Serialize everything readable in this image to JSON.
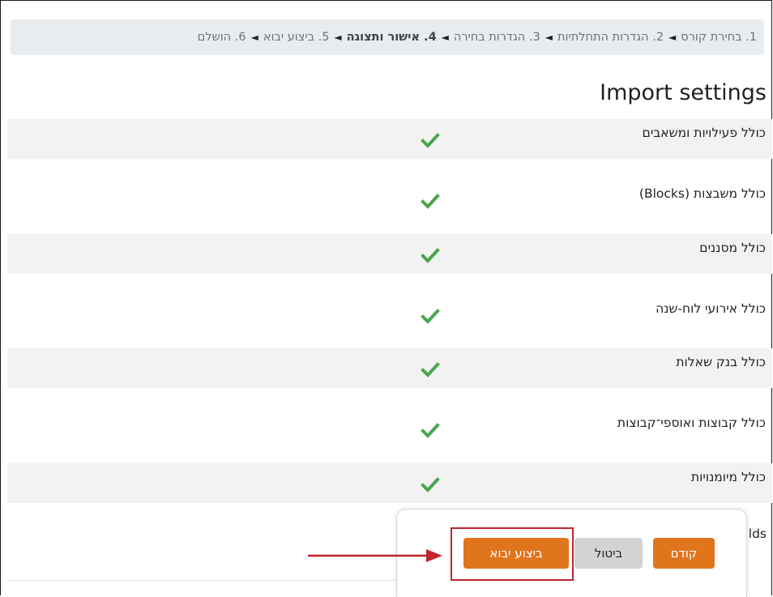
{
  "breadcrumb": {
    "separator": "◄",
    "steps": [
      {
        "label": "1. בחירת קורס",
        "current": false
      },
      {
        "label": "2. הגדרות התחלתיות",
        "current": false
      },
      {
        "label": "3. הגדרות בחירה",
        "current": false
      },
      {
        "label": "4. אישור ותצוגה",
        "current": true
      },
      {
        "label": "5. ביצוע יבוא",
        "current": false
      },
      {
        "label": "6. הושלם",
        "current": false
      }
    ]
  },
  "section": {
    "title": "Import settings"
  },
  "settings": [
    {
      "label": "כולל פעילויות ומשאבים",
      "enabled": true
    },
    {
      "label": "כולל משבצות (Blocks)",
      "enabled": true
    },
    {
      "label": "כולל מסננים",
      "enabled": true
    },
    {
      "label": "כולל אירועי לוח-שנה",
      "enabled": true
    },
    {
      "label": "כולל בנק שאלות",
      "enabled": true
    },
    {
      "label": "כולל קבוצות ואוספי־קבוצות",
      "enabled": true
    },
    {
      "label": "כולל מיומנויות",
      "enabled": true
    }
  ],
  "partially_hidden_row_text": "lds",
  "buttons": {
    "import": "ביצוע יבוא",
    "cancel": "ביטול",
    "previous": "קודם"
  },
  "colors": {
    "accent": "#e1751e",
    "check": "#4aa54a",
    "annotation": "#c0262c"
  }
}
